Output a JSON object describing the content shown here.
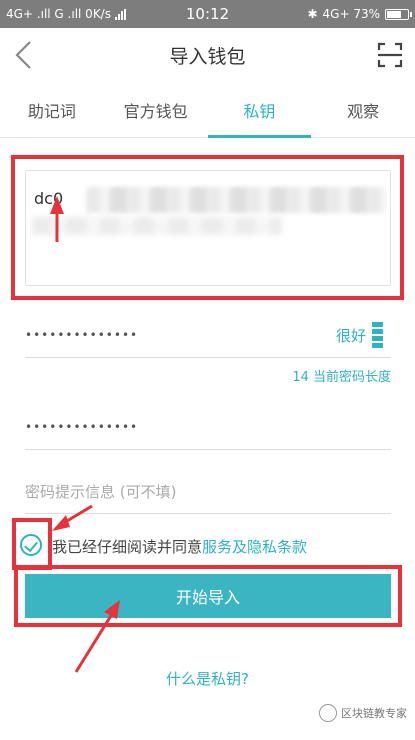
{
  "status": {
    "left_text": "4G+ .ıll G .ıll 0K/s",
    "time": "10:12",
    "right_text": "4G+ 73%"
  },
  "header": {
    "title": "导入钱包"
  },
  "tabs": [
    {
      "label": "助记词"
    },
    {
      "label": "官方钱包"
    },
    {
      "label": "私钥"
    },
    {
      "label": "观察"
    }
  ],
  "form": {
    "private_key_value": "dc0",
    "password_dots": "••••••••••••••",
    "confirm_dots": "••••••••••••••",
    "strength_label": "很好",
    "length_note": "14 当前密码长度",
    "hint_placeholder": "密码提示信息 (可不填)",
    "agree_prefix": "我已经仔细阅读并同意",
    "agree_link": "服务及隐私条款",
    "import_button": "开始导入",
    "what_is_link": "什么是私钥?"
  },
  "watermark": {
    "text": "区块链教专家"
  },
  "colors": {
    "accent": "#2fb3c0",
    "button": "#3cb5c3",
    "annotation_red": "#e8323b"
  }
}
